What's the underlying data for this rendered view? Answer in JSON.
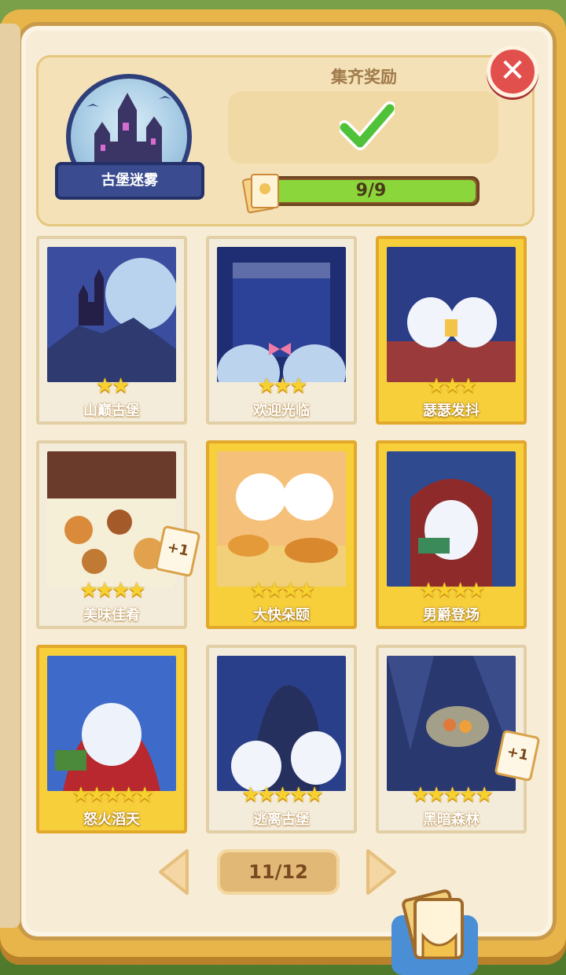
{
  "collection": {
    "name": "古堡迷雾",
    "reward_title": "集齐奖励",
    "reward_claimed": true,
    "progress_text": "9/9",
    "progress_fraction": 1.0
  },
  "cards": [
    {
      "name": "山巅古堡",
      "stars": "★★",
      "gold": false,
      "plus": ""
    },
    {
      "name": "欢迎光临",
      "stars": "★★★",
      "gold": false,
      "plus": ""
    },
    {
      "name": "瑟瑟发抖",
      "stars": "★★★",
      "gold": true,
      "plus": ""
    },
    {
      "name": "美味佳肴",
      "stars": "★★★★",
      "gold": false,
      "plus": "+1"
    },
    {
      "name": "大快朵颐",
      "stars": "★★★★",
      "gold": true,
      "plus": ""
    },
    {
      "name": "男爵登场",
      "stars": "★★★★",
      "gold": true,
      "plus": ""
    },
    {
      "name": "怒火滔天",
      "stars": "★★★★★",
      "gold": true,
      "plus": ""
    },
    {
      "name": "逃离古堡",
      "stars": "★★★★★",
      "gold": false,
      "plus": ""
    },
    {
      "name": "黑暗森林",
      "stars": "★★★★★",
      "gold": false,
      "plus": "+1"
    }
  ],
  "pager": {
    "text": "11/12"
  },
  "icons": {
    "close": "close-icon",
    "check": "checkmark-icon",
    "prev": "arrow-left-icon",
    "next": "arrow-right-icon",
    "album": "card-album-icon"
  },
  "colors": {
    "gold": "#f6cf3b",
    "progress": "#8bd63a",
    "close": "#e2504e"
  }
}
